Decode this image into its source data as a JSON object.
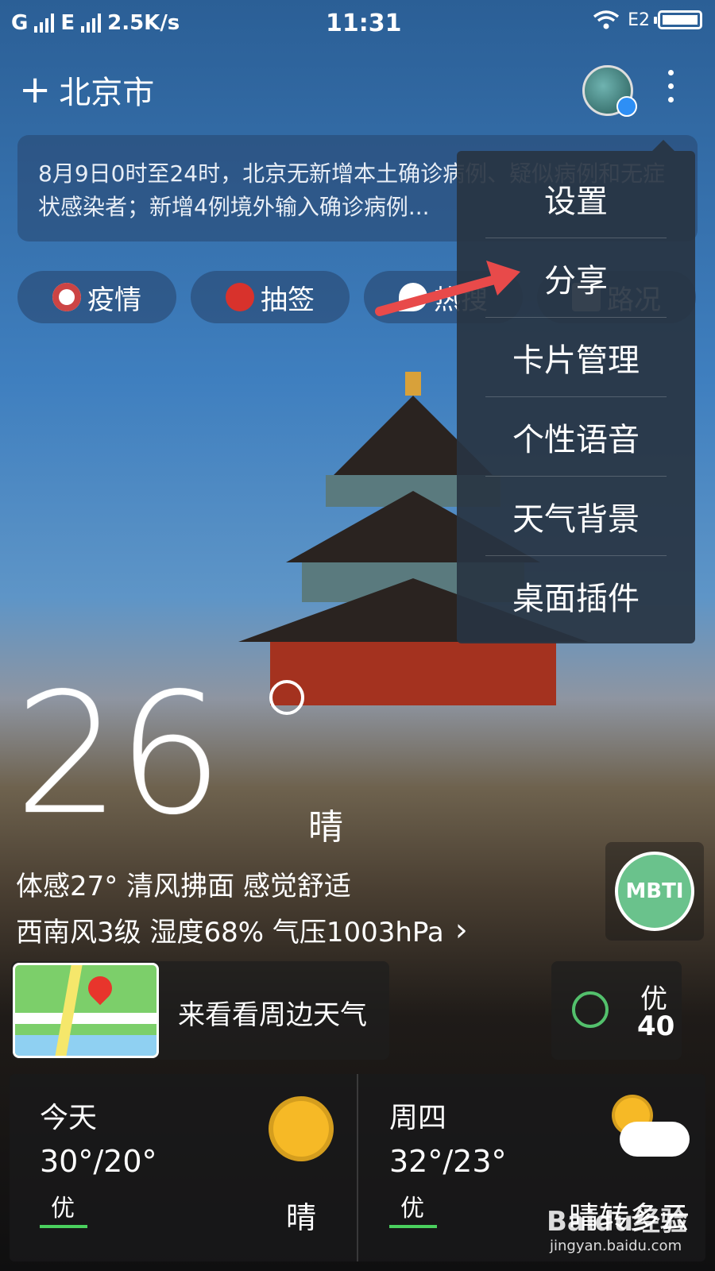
{
  "status_bar": {
    "carrier_left": "G",
    "carrier_mid": "E",
    "speed": "2.5K/s",
    "time": "11:31",
    "right_net": "E2"
  },
  "header": {
    "add_symbol": "+",
    "city": "北京市"
  },
  "news": {
    "text": "8月9日0时至24时，北京无新增本土确诊病例、疑似病例和无症状感染者；新增4例境外输入确诊病例..."
  },
  "chips": [
    {
      "label": "疫情",
      "icon": "virus-icon"
    },
    {
      "label": "抽签",
      "icon": "fortune-icon"
    },
    {
      "label": "热搜",
      "icon": "fire-icon"
    },
    {
      "label": "路况",
      "icon": "road-icon"
    }
  ],
  "weather": {
    "temp": "26",
    "condition": "晴",
    "feels": "体感27° 清风拂面 感觉舒适",
    "wind_line": "西南风3级 湿度68% 气压1003hPa",
    "chevron": "›"
  },
  "mbti": {
    "label": "MBTI"
  },
  "map_card": {
    "label": "来看看周边天气"
  },
  "aqi": {
    "quality": "优",
    "value": "40"
  },
  "forecast": [
    {
      "day": "今天",
      "range": "30°/20°",
      "aq": "优",
      "condition": "晴"
    },
    {
      "day": "周四",
      "range": "32°/23°",
      "aq": "优",
      "condition": "晴转多云"
    }
  ],
  "menu": {
    "items": [
      "设置",
      "分享",
      "卡片管理",
      "个性语音",
      "天气背景",
      "桌面插件"
    ]
  },
  "watermark": {
    "line1": "Baidu经验",
    "line2": "jingyan.baidu.com"
  },
  "colors": {
    "accent_red": "#e8352c",
    "aqi_green": "#53c06c"
  }
}
